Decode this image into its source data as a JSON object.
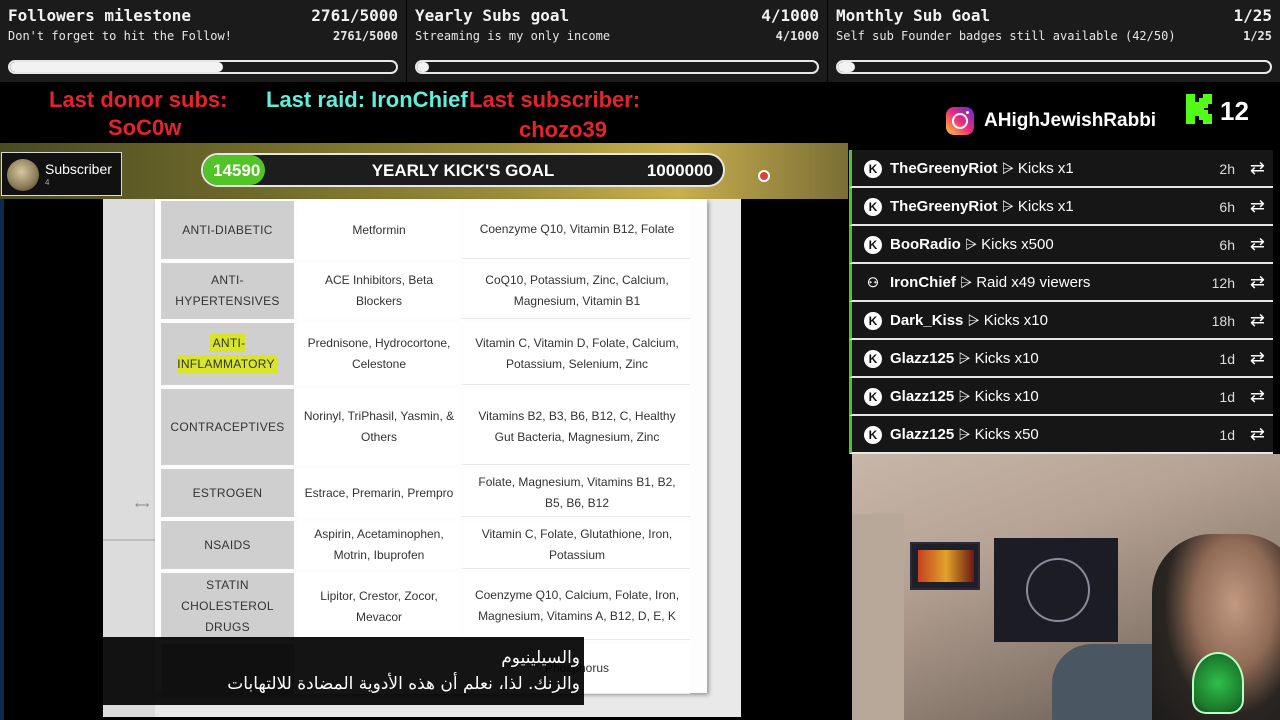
{
  "goals": [
    {
      "title": "Followers milestone",
      "count": "2761/5000",
      "subtitle": "Don't forget to hit the Follow!",
      "progress": 0.5522
    },
    {
      "title": "Yearly Subs goal",
      "count": "4/1000",
      "subtitle": "Streaming is my only income",
      "progress": 0.004
    },
    {
      "title": "Monthly Sub Goal",
      "count": "1/25",
      "subtitle": "Self sub Founder badges still available (42/50)",
      "progress": 0.04
    }
  ],
  "last_events": {
    "donor_label": "Last donor subs:",
    "donor_name": "SoC0w",
    "raid_label": "Last raid: IronChief",
    "subscriber_label": "Last subscriber:",
    "subscriber_name": "chozo39"
  },
  "social": {
    "instagram_icon": "instagram-icon",
    "instagram_handle": "AHighJewishRabbi",
    "kick_icon": "kick-logo-icon",
    "kick_count": "12"
  },
  "subscriber_badge": {
    "label": "Subscriber",
    "count": "4"
  },
  "kicks_goal": {
    "current": "14590",
    "title": "YEARLY KICK'S GOAL",
    "target": "1000000",
    "progress": 0.01459
  },
  "colors": {
    "kick_green": "#53c427",
    "alert_red": "#e3242b",
    "raid_cyan": "#5ff0dc"
  },
  "document_table": {
    "rows": [
      {
        "category": "ANTI-DIABETIC",
        "drugs": "Metformin",
        "nutrients": "Coenzyme Q10, Vitamin B12, Folate",
        "highlighted": false
      },
      {
        "category": "ANTI-HYPERTENSIVES",
        "drugs": "ACE Inhibitors, Beta Blockers",
        "nutrients": "CoQ10, Potassium, Zinc, Calcium, Magnesium, Vitamin B1",
        "highlighted": false
      },
      {
        "category": "ANTI-INFLAMMATORY",
        "drugs": "Prednisone, Hydrocortone, Celestone",
        "nutrients": "Vitamin C, Vitamin D, Folate, Calcium, Potassium, Selenium, Zinc",
        "highlighted": true
      },
      {
        "category": "CONTRACEPTIVES",
        "drugs": "Norinyl, TriPhasil, Yasmin, & Others",
        "nutrients": "Vitamins B2, B3, B6, B12, C, Healthy Gut Bacteria, Magnesium, Zinc",
        "highlighted": false
      },
      {
        "category": "ESTROGEN",
        "drugs": "Estrace, Premarin, Prempro",
        "nutrients": "Folate, Magnesium, Vitamins B1, B2, B5, B6, B12",
        "highlighted": false
      },
      {
        "category": "NSAIDS",
        "drugs": "Aspirin, Acetaminophen, Motrin, Ibuprofen",
        "nutrients": "Vitamin C, Folate, Glutathione, Iron, Potassium",
        "highlighted": false
      },
      {
        "category": "STATIN CHOLESTEROL DRUGS",
        "drugs": "Lipitor, Crestor, Zocor, Mevacor",
        "nutrients": "Coenzyme Q10, Calcium, Folate, Iron, Magnesium, Vitamins A, B12, D, E, K",
        "highlighted": false
      },
      {
        "category": "",
        "drugs": "",
        "nutrients": "Phosphorus",
        "highlighted": false
      }
    ]
  },
  "caption": {
    "line1": "والسيلينيوم",
    "line2": "والزنك. لذا، نعلم أن هذه الأدوية المضادة للالتهابات"
  },
  "feed": [
    {
      "user": "TheGreenyRiot",
      "action": "Kicks x1",
      "time": "2h",
      "icon": "kick-icon"
    },
    {
      "user": "TheGreenyRiot",
      "action": "Kicks x1",
      "time": "6h",
      "icon": "kick-icon"
    },
    {
      "user": "BooRadio",
      "action": "Kicks x500",
      "time": "6h",
      "icon": "kick-icon"
    },
    {
      "user": "IronChief",
      "action": "Raid x49 viewers",
      "time": "12h",
      "icon": "raid-icon"
    },
    {
      "user": "Dark_Kiss",
      "action": "Kicks x10",
      "time": "18h",
      "icon": "kick-icon"
    },
    {
      "user": "Glazz125",
      "action": "Kicks x10",
      "time": "1d",
      "icon": "kick-icon"
    },
    {
      "user": "Glazz125",
      "action": "Kicks x10",
      "time": "1d",
      "icon": "kick-icon"
    },
    {
      "user": "Glazz125",
      "action": "Kicks x50",
      "time": "1d",
      "icon": "kick-icon"
    }
  ]
}
